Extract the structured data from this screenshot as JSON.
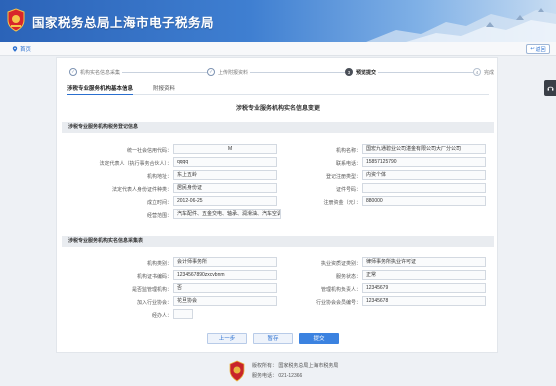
{
  "header": {
    "title": "国家税务总局上海市电子税务局"
  },
  "crumb": {
    "home": "首页",
    "back": "返回"
  },
  "steps": [
    {
      "num": "✓",
      "label": "机构实名信息采集",
      "state": "done"
    },
    {
      "num": "✓",
      "label": "上传附报资料",
      "state": "done"
    },
    {
      "num": "3",
      "label": "预览提交",
      "state": "active"
    },
    {
      "num": "4",
      "label": "完成",
      "state": "todo"
    }
  ],
  "tabs": {
    "active": "涉税专业服务机构基本信息",
    "other": "附报资料"
  },
  "page_title": "涉税专业服务机构实名信息变更",
  "section1": {
    "title": "涉税专业服务机构税务登记信息",
    "left": [
      {
        "label": "统一社会信用代码：",
        "value": "M"
      },
      {
        "label": "法定代表人（执行事务合伙人）：",
        "value": "qqqq"
      },
      {
        "label": "机构地址：",
        "value": "东上五岭"
      },
      {
        "label": "法定代表人身份证件种类：",
        "value": "居民身份证"
      },
      {
        "label": "成立时间：",
        "value": "2012-06-25"
      },
      {
        "label": "经营范围：",
        "value": "汽车配件、五金交电、轴承、润滑油、汽车空调、普通"
      }
    ],
    "right": [
      {
        "label": "机构名称：",
        "value": "国宏九通碧业公司湛金有限公司大厂分公司"
      },
      {
        "label": "联系电话：",
        "value": "15857125790"
      },
      {
        "label": "登记注册类型：",
        "value": "内资个体"
      },
      {
        "label": "证件号码：",
        "value": ""
      },
      {
        "label": "注册资金（元）：",
        "value": "880000"
      }
    ]
  },
  "section2": {
    "title": "涉税专业服务机构实名信息采集表",
    "left": [
      {
        "label": "机构类别：",
        "value": "会计师事务所"
      },
      {
        "label": "机构证书编码：",
        "value": "1234567890zxcvbnm"
      },
      {
        "label": "是否监管理机构：",
        "value": "否"
      },
      {
        "label": "加入行业协会：",
        "value": "花旦协会"
      },
      {
        "label": "经办人：",
        "value": ""
      }
    ],
    "right": [
      {
        "label": "执业资质证类别：",
        "value": "律师事务所执业许可证"
      },
      {
        "label": "服务状态：",
        "value": "正常"
      },
      {
        "label": "管理机构负责人：",
        "value": "12345679"
      },
      {
        "label": "行业协会会员编号：",
        "value": "12345678"
      }
    ]
  },
  "buttons": {
    "prev": "上一步",
    "save": "暂存",
    "submit": "提交"
  },
  "footer": {
    "rights": "版权所有：  国家税务总局上海市税务局",
    "hotline": "服务电话：  021-12366"
  }
}
